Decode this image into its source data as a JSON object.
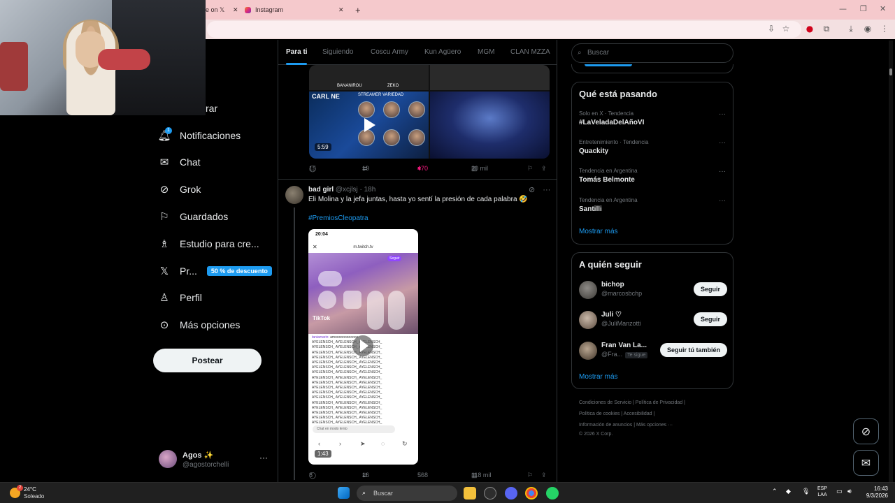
{
  "browser": {
    "tabs": [
      {
        "label": "e on 𝕏"
      },
      {
        "label": "Instagram"
      }
    ],
    "new_tab_icon": "plus-icon"
  },
  "sidebar": {
    "partial_item_label": "rar",
    "notification_count": "1",
    "items": [
      {
        "label": "Notificaciones",
        "icon": "bell-icon"
      },
      {
        "label": "Chat",
        "icon": "envelope-icon"
      },
      {
        "label": "Grok",
        "icon": "grok-icon"
      },
      {
        "label": "Guardados",
        "icon": "bookmark-icon"
      },
      {
        "label": "Estudio para cre...",
        "icon": "studio-icon"
      },
      {
        "label": "Pr...",
        "icon": "x-logo-icon",
        "badge": "50 % de descuento"
      },
      {
        "label": "Perfil",
        "icon": "person-icon"
      },
      {
        "label": "Más opciones",
        "icon": "more-circle-icon"
      }
    ],
    "post_button": "Postear",
    "account": {
      "name": "Agos ✨",
      "handle": "@agostorchelli"
    }
  },
  "feed": {
    "tabs": [
      "Para ti",
      "Siguiendo",
      "Coscu Army",
      "Kun Agüero",
      "MGM",
      "CLAN MZZA"
    ],
    "post1": {
      "media_labels": [
        "BANANIROU",
        "ZEKO",
        "STREAMER VARIEDAD",
        "CARL NE"
      ],
      "video_duration": "5:59",
      "replies": "15",
      "reposts": "19",
      "likes": "470",
      "views": "20 mil"
    },
    "post2": {
      "author": "bad girl",
      "handle": "@xcjlsj",
      "time": "· 18h",
      "text": "Eli Molina y la jefa juntas, hasta yo sentí la presión de cada palabra 🤣",
      "hashtag": "#PremiosCleopatra",
      "phone": {
        "time": "20:04",
        "url": "m.twitch.tv",
        "follow": "Seguir",
        "tiktok": "TikTok",
        "chat_first_user": "taniamarin:",
        "chat_first_msg": "amoooooooooooo",
        "chat_line": "AYELENSCH_ AYELENSCH_ AYELENSCH_",
        "chat_input": "Chat en modo lento",
        "video_duration": "1:43"
      },
      "replies": "8",
      "reposts": "16",
      "likes": "568",
      "views": "118 mil"
    }
  },
  "right": {
    "search_placeholder": "Buscar",
    "trending_title": "Qué está pasando",
    "trends": [
      {
        "category": "Solo en X · Tendencia",
        "name": "#LaVeladaDelAñoVI"
      },
      {
        "category": "Entretenimiento · Tendencia",
        "name": "Quackity"
      },
      {
        "category": "Tendencia en Argentina",
        "name": "Tomás Belmonte"
      },
      {
        "category": "Tendencia en Argentina",
        "name": "Santilli"
      }
    ],
    "show_more": "Mostrar más",
    "who_to_follow_title": "A quién seguir",
    "follow_suggestions": [
      {
        "name": "bichop",
        "handle": "@marcosbchp",
        "button": "Seguir"
      },
      {
        "name": "Juli ♡",
        "handle": "@JuliManzotti",
        "button": "Seguir"
      },
      {
        "name": "Fran Van La...",
        "handle": "@Fra...",
        "follows_you": "Te sigue",
        "button": "Seguir tú también"
      }
    ],
    "footer_line1": "Condiciones de Servicio  |  Política de Privacidad  |",
    "footer_line2": "Política de cookies  |  Accesibilidad  |",
    "footer_line3": "Información de anuncios  |  Más opciones ···",
    "footer_line4": "© 2026 X Corp."
  },
  "taskbar": {
    "temp": "24°C",
    "weather": "Soleado",
    "weather_badge": "2",
    "search": "Buscar",
    "lang_top": "ESP",
    "lang_bottom": "LAA",
    "time": "16:43",
    "date": "9/3/2026"
  },
  "colors": {
    "accent": "#1d9bf0",
    "like": "#f91880",
    "tab_bar": "#f5c9cc"
  }
}
